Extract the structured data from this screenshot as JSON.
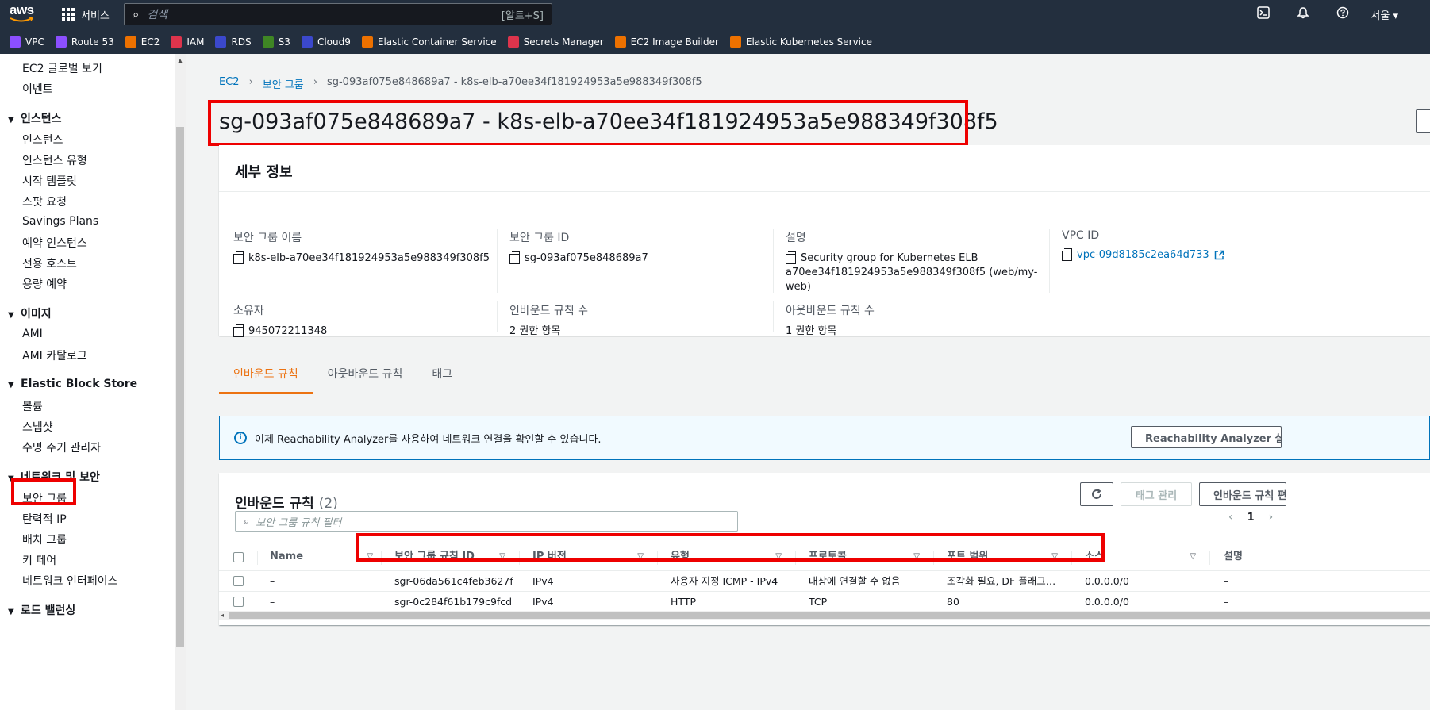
{
  "topnav": {
    "logo": "aws",
    "services_label": "서비스",
    "search_placeholder": "검색",
    "search_shortcut": "[알트+S]",
    "region": "서울 ▾",
    "icons": [
      "cloudshell-icon",
      "notifications-icon",
      "help-icon"
    ]
  },
  "favorites": [
    {
      "label": "VPC",
      "color": "#8c4fff"
    },
    {
      "label": "Route 53",
      "color": "#8c4fff"
    },
    {
      "label": "EC2",
      "color": "#ed7100"
    },
    {
      "label": "IAM",
      "color": "#dd344c"
    },
    {
      "label": "RDS",
      "color": "#3b48cc"
    },
    {
      "label": "S3",
      "color": "#3f8624"
    },
    {
      "label": "Cloud9",
      "color": "#3b48cc"
    },
    {
      "label": "Elastic Container Service",
      "color": "#ed7100"
    },
    {
      "label": "Secrets Manager",
      "color": "#dd344c"
    },
    {
      "label": "EC2 Image Builder",
      "color": "#ed7100"
    },
    {
      "label": "Elastic Kubernetes Service",
      "color": "#ed7100"
    }
  ],
  "sidebar": {
    "global_view": "EC2 글로벌 보기",
    "events": "이벤트",
    "instances_head": "인스턴스",
    "instances": [
      "인스턴스",
      "인스턴스 유형",
      "시작 템플릿",
      "스팟 요청",
      "Savings Plans",
      "예약 인스턴스",
      "전용 호스트",
      "용량 예약"
    ],
    "images_head": "이미지",
    "images": [
      "AMI",
      "AMI 카탈로그"
    ],
    "ebs_head": "Elastic Block Store",
    "ebs": [
      "볼륨",
      "스냅샷",
      "수명 주기 관리자"
    ],
    "network_head": "네트워크 및 보안",
    "network": [
      "보안 그룹",
      "탄력적 IP",
      "배치 그룹",
      "키 페어",
      "네트워크 인터페이스"
    ],
    "lb_head": "로드 밸런싱"
  },
  "breadcrumb": {
    "ec2": "EC2",
    "sg": "보안 그룹",
    "current": "sg-093af075e848689a7 - k8s-elb-a70ee34f181924953a5e988349f308f5"
  },
  "page_title": "sg-093af075e848689a7 - k8s-elb-a70ee34f181924953a5e988349f308f5",
  "details": {
    "header": "세부 정보",
    "sg_name_label": "보안 그룹 이름",
    "sg_name": "k8s-elb-a70ee34f181924953a5e988349f308f5",
    "sg_id_label": "보안 그룹 ID",
    "sg_id": "sg-093af075e848689a7",
    "desc_label": "설명",
    "desc_line1": "Security group for Kubernetes ELB",
    "desc_line2": "a70ee34f181924953a5e988349f308f5 (web/my-web)",
    "vpc_label": "VPC ID",
    "vpc_id": "vpc-09d8185c2ea64d733",
    "owner_label": "소유자",
    "owner": "945072211348",
    "inbound_count_label": "인바운드 규칙 수",
    "inbound_count": "2 권한 항목",
    "outbound_count_label": "아웃바운드 규칙 수",
    "outbound_count": "1 권한 항목"
  },
  "tabs": [
    "인바운드 규칙",
    "아웃바운드 규칙",
    "태그"
  ],
  "alert": {
    "text": "이제 Reachability Analyzer를 사용하여 네트워크 연결을 확인할 수 있습니다.",
    "button": "Reachability Analyzer 실행"
  },
  "rules": {
    "title": "인바운드 규칙",
    "count": "(2)",
    "manage_tags": "태그 관리",
    "edit_button": "인바운드 규칙 편집",
    "filter_placeholder": "보안 그룹 규칙 필터",
    "page": "1",
    "columns": [
      "Name",
      "보안 그룹 규칙 ID",
      "IP 버전",
      "유형",
      "프로토콜",
      "포트 범위",
      "소스",
      "설명"
    ],
    "rows": [
      [
        "–",
        "sgr-06da561c4feb3627f",
        "IPv4",
        "사용자 지정 ICMP - IPv4",
        "대상에 연결할 수 없음",
        "조각화 필요, DF 플래그…",
        "0.0.0.0/0",
        "–"
      ],
      [
        "–",
        "sgr-0c284f61b179c9fcd",
        "IPv4",
        "HTTP",
        "TCP",
        "80",
        "0.0.0.0/0",
        "–"
      ]
    ]
  }
}
